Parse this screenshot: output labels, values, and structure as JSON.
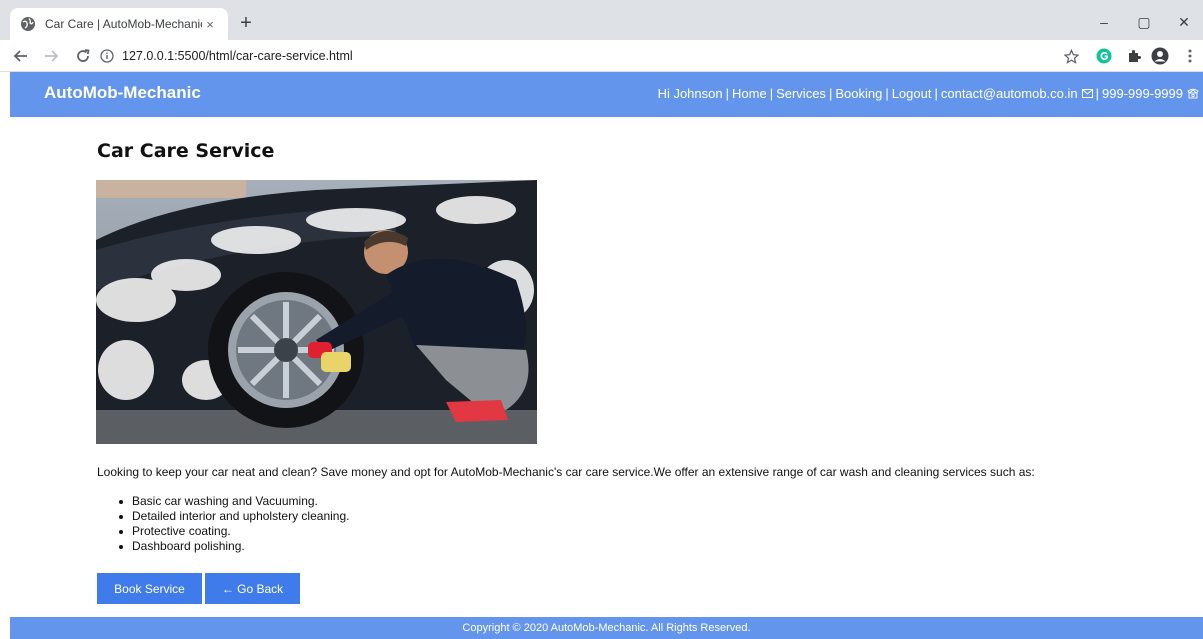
{
  "browser": {
    "tab_title": "Car Care | AutoMob-Mechanic",
    "tab_close": "×",
    "new_tab": "+",
    "url": "127.0.0.1:5500/html/car-care-service.html",
    "controls": {
      "minimize": "–",
      "maximize": "▢",
      "close": "✕"
    },
    "icons": [
      "globe-icon",
      "back-arrow-icon",
      "forward-arrow-icon",
      "reload-icon",
      "info-icon",
      "star-icon",
      "grammarly-icon",
      "extensions-icon",
      "profile-icon",
      "menu-icon"
    ]
  },
  "header": {
    "brand": "AutoMob-Mechanic",
    "nav": {
      "greeting": "Hi Johnson",
      "home": "Home",
      "services": "Services",
      "booking": "Booking",
      "logout": "Logout",
      "email": "contact@automob.co.in",
      "phone": "999-999-9999",
      "separator": "|"
    },
    "color": "#6495ed"
  },
  "main": {
    "title": "Car Care Service",
    "intro": "Looking to keep your car neat and clean? Save money and opt for AutoMob-Mechanic's car care service.We offer an extensive range of car wash and cleaning services such as:",
    "services": [
      "Basic car washing and Vacuuming.",
      "Detailed interior and upholstery cleaning.",
      "Protective coating.",
      "Dashboard polishing."
    ],
    "buttons": {
      "book": "Book Service",
      "back": "← Go Back"
    },
    "button_color": "#3f7bea"
  },
  "footer": {
    "copyright": "Copyright © 2020 AutoMob-Mechanic. All Rights Reserved."
  }
}
